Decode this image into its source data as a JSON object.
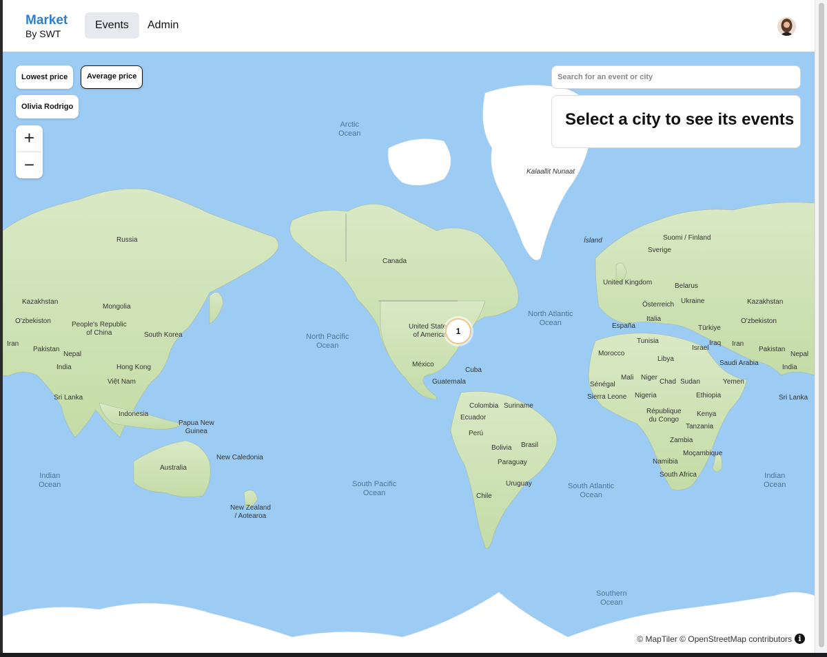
{
  "header": {
    "brand_title": "Market",
    "brand_subtitle": "By SWT",
    "nav": [
      {
        "label": "Events",
        "active": true
      },
      {
        "label": "Admin",
        "active": false
      }
    ],
    "avatar_icon": "user-avatar"
  },
  "filters": {
    "lowest_price": "Lowest price",
    "average_price": "Average price",
    "selected": "Average price",
    "artist": "Olivia Rodrigo"
  },
  "zoom": {
    "in_label": "+",
    "out_label": "−"
  },
  "search": {
    "placeholder": "Search for an event or city",
    "value": ""
  },
  "panel": {
    "title": "Select a city to see its events"
  },
  "map": {
    "cluster_count": "1",
    "attribution": "© MapTiler © OpenStreetMap contributors",
    "info_icon": "info-icon",
    "colors": {
      "ocean": "#9ccbf3",
      "land": "#cfe3b4",
      "ice": "#ffffff",
      "cluster_ring": "#f0c58a"
    },
    "labels": {
      "arctic": "Arctic\nOcean",
      "kalaallit": "Kalaallit Nunaat",
      "island": "Ísland",
      "russia": "Russia",
      "canada": "Canada",
      "suomi": "Suomi / Finland",
      "sverige": "Sverige",
      "uk": "United Kingdom",
      "belarus": "Belarus",
      "osterreich": "Österreich",
      "ukraine": "Ukraine",
      "kazakhstan_w": "Kazakhstan",
      "kazakhstan_e": "Kazakhstan",
      "mongolia": "Mongolia",
      "ozbek_w": "O'zbekiston",
      "ozbek_e": "O'zbekiston",
      "china": "People's Republic\nof China",
      "south_korea": "South Korea",
      "iran_w": "Iran",
      "iran_e": "Iran",
      "pakistan_w": "Pakistan",
      "pakistan_e": "Pakistan",
      "nepal_w": "Nepal",
      "nepal_e": "Nepal",
      "india_w": "India",
      "india_e": "India",
      "hong_kong": "Hong Kong",
      "viet_nam": "Việt Nam",
      "sri_lanka_w": "Sri Lanka",
      "sri_lanka_e": "Sri Lanka",
      "indonesia": "Indonesia",
      "png": "Papua New\nGuinea",
      "new_caledonia": "New Caledonia",
      "australia": "Australia",
      "nz": "New Zealand\n/ Aotearoa",
      "usa": "United States\nof America",
      "mexico": "México",
      "cuba": "Cuba",
      "guatemala": "Guatemala",
      "colombia": "Colombia",
      "suriname": "Suriname",
      "ecuador": "Ecuador",
      "peru": "Perú",
      "brasil": "Brasil",
      "bolivia": "Bolivia",
      "paraguay": "Paraguay",
      "uruguay": "Uruguay",
      "chile": "Chile",
      "espana": "España",
      "italia": "Italia",
      "turkiye": "Türkiye",
      "tunisia": "Tunisia",
      "iraq": "Iraq",
      "israel": "Israel",
      "morocco": "Morocco",
      "libya": "Libya",
      "saudi": "Saudi Arabia",
      "yemen": "Yemen",
      "senegal": "Sénégal",
      "sierra": "Sierra Leone",
      "mali": "Mali",
      "niger": "Niger",
      "chad": "Chad",
      "sudan": "Sudan",
      "nigeria": "Nigeria",
      "ethiopia": "Ethiopia",
      "rdc": "République\ndu Congo",
      "kenya": "Kenya",
      "tanzania": "Tanzania",
      "zambia": "Zambia",
      "namibia": "Namibia",
      "mozambique": "Moçambique",
      "south_africa": "South Africa",
      "north_pacific": "North Pacific\nOcean",
      "north_atlantic": "North Atlantic\nOcean",
      "south_pacific": "South Pacific\nOcean",
      "south_atlantic": "South Atlantic\nOcean",
      "indian_w": "Indian\nOcean",
      "indian_e": "Indian\nOcean",
      "southern": "Southern\nOcean"
    }
  }
}
